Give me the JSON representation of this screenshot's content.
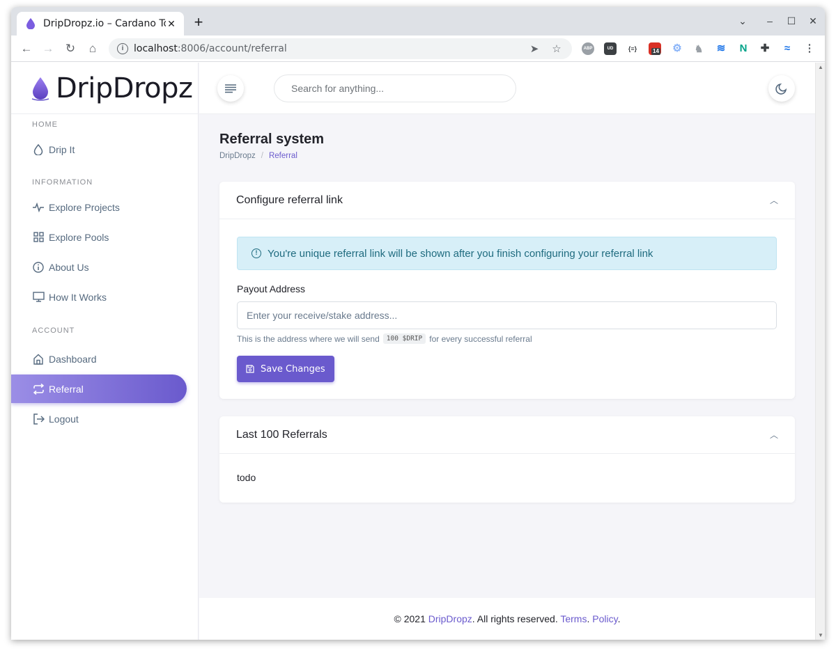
{
  "browser": {
    "tab_title": "DripDropz.io – Cardano To",
    "url_host": "localhost",
    "url_rest": ":8006/account/referral",
    "ext_badge": "14",
    "ext_abp": "ABP",
    "ext_ud": "UD",
    "ext_json": "{≡}"
  },
  "sidebar": {
    "brand": "DripDropz",
    "sections": [
      {
        "header": "HOME",
        "items": [
          {
            "label": "Drip It",
            "icon": "drop-icon"
          }
        ]
      },
      {
        "header": "INFORMATION",
        "items": [
          {
            "label": "Explore Projects",
            "icon": "activity-icon"
          },
          {
            "label": "Explore Pools",
            "icon": "grid-icon"
          },
          {
            "label": "About Us",
            "icon": "info-icon"
          },
          {
            "label": "How It Works",
            "icon": "monitor-icon"
          }
        ]
      },
      {
        "header": "ACCOUNT",
        "items": [
          {
            "label": "Dashboard",
            "icon": "home-icon"
          },
          {
            "label": "Referral",
            "icon": "repeat-icon",
            "active": true
          },
          {
            "label": "Logout",
            "icon": "logout-icon"
          }
        ]
      }
    ]
  },
  "topnav": {
    "search_placeholder": "Search for anything..."
  },
  "main": {
    "title": "Referral system",
    "breadcrumb": {
      "root": "DripDropz",
      "sep": "/",
      "current": "Referral"
    },
    "config_card": {
      "title": "Configure referral link",
      "alert": "You're unique referral link will be shown after you finish configuring your referral link",
      "payout_label": "Payout Address",
      "payout_placeholder": "Enter your receive/stake address...",
      "help_before": "This is the address where we will send",
      "help_code": "100 $DRIP",
      "help_after": "for every successful referral",
      "save_label": "Save Changes"
    },
    "referrals_card": {
      "title": "Last 100 Referrals",
      "body": "todo"
    }
  },
  "footer": {
    "prefix": "© 2021",
    "brand": "DripDropz",
    "middle": ". All rights reserved.",
    "terms": "Terms",
    "policy": "Policy",
    "dot": "."
  },
  "colors": {
    "accent": "#6a5acd",
    "alert_bg": "#d7eff8",
    "alert_text": "#1f6b7f",
    "page_bg": "#f5f5f9"
  }
}
